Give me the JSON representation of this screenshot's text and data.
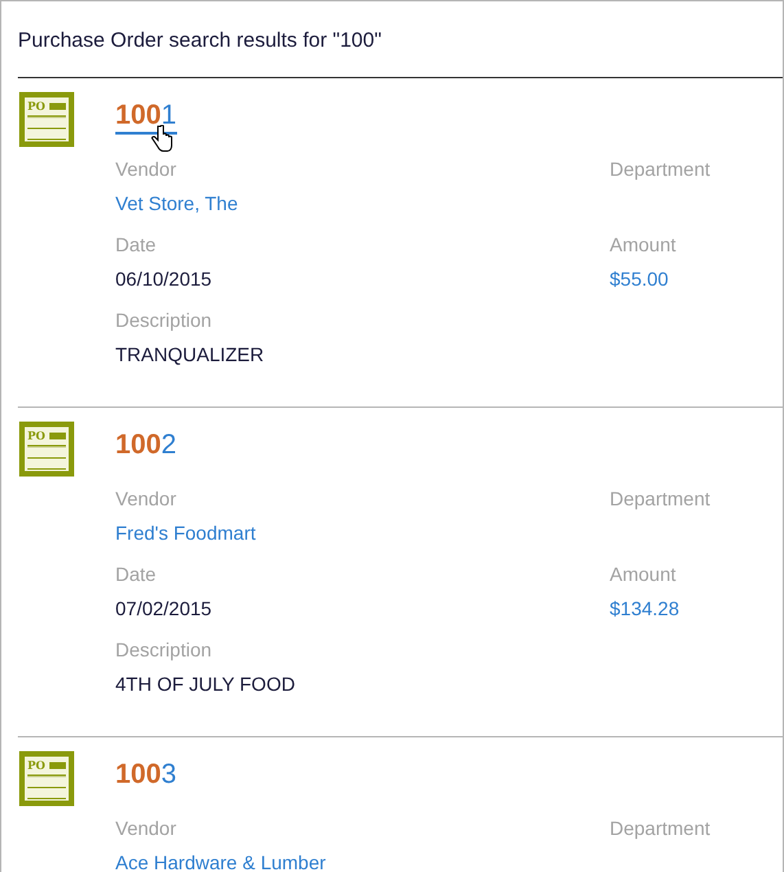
{
  "heading": "Purchase Order search results for \"100\"",
  "results": [
    {
      "icon_label": "PO",
      "number_match": "100",
      "number_rest": "1",
      "hovered": true,
      "rows": [
        {
          "left": {
            "label": "Vendor",
            "value": "Vet Store, The",
            "kind": "link"
          },
          "right": {
            "label": "Department"
          }
        },
        {
          "left": {
            "label": "Date",
            "value": "06/10/2015",
            "kind": "text"
          },
          "right": {
            "label": "Amount",
            "value": "$55.00",
            "kind": "link"
          }
        },
        {
          "left": {
            "label": "Description",
            "value": "TRANQUALIZER",
            "kind": "text"
          }
        }
      ]
    },
    {
      "icon_label": "PO",
      "number_match": "100",
      "number_rest": "2",
      "hovered": false,
      "rows": [
        {
          "left": {
            "label": "Vendor",
            "value": "Fred's Foodmart",
            "kind": "link"
          },
          "right": {
            "label": "Department"
          }
        },
        {
          "left": {
            "label": "Date",
            "value": "07/02/2015",
            "kind": "text"
          },
          "right": {
            "label": "Amount",
            "value": "$134.28",
            "kind": "link"
          }
        },
        {
          "left": {
            "label": "Description",
            "value": "4TH OF JULY FOOD",
            "kind": "text"
          }
        }
      ]
    },
    {
      "icon_label": "PO",
      "number_match": "100",
      "number_rest": "3",
      "hovered": false,
      "rows": [
        {
          "left": {
            "label": "Vendor",
            "value": "Ace Hardware & Lumber",
            "kind": "link"
          },
          "right": {
            "label": "Department"
          }
        }
      ]
    }
  ]
}
